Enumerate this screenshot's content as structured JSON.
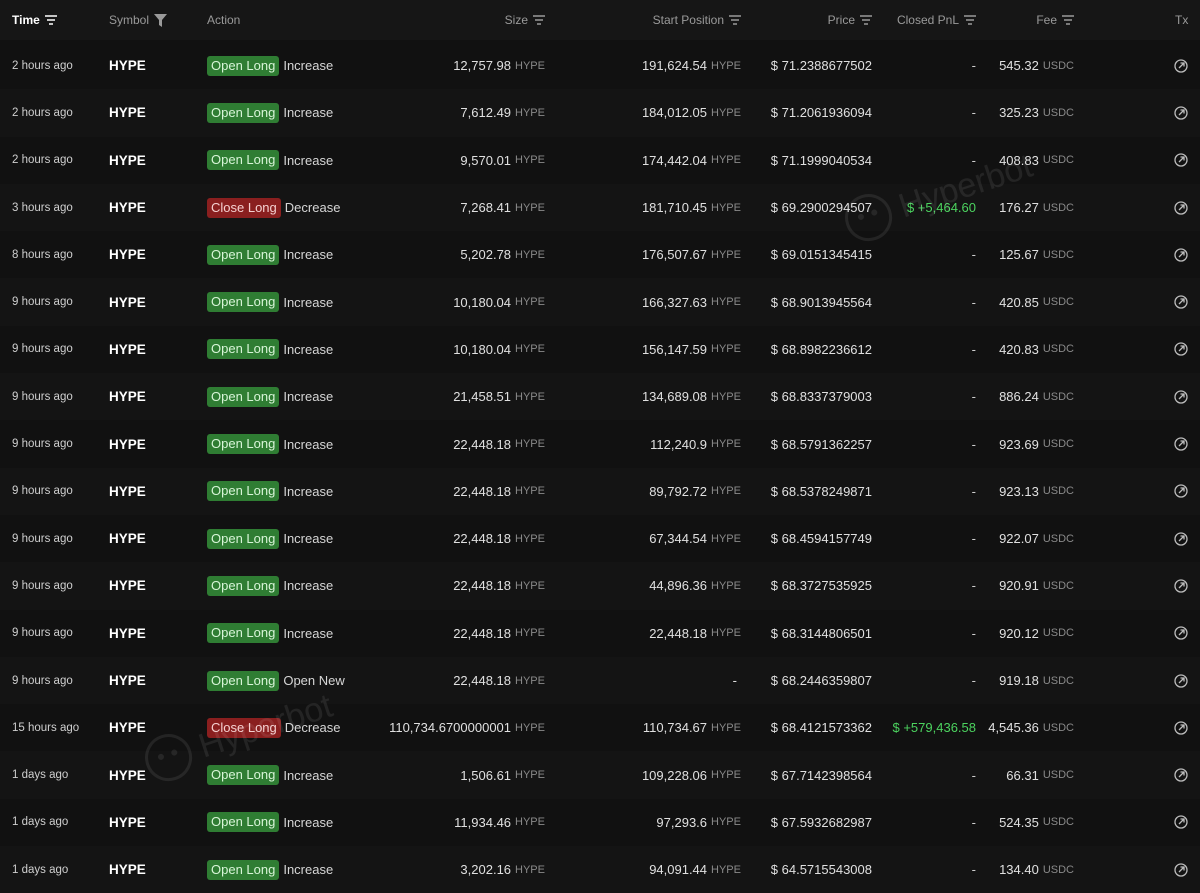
{
  "header": {
    "time": "Time",
    "symbol": "Symbol",
    "action": "Action",
    "size": "Size",
    "start_position": "Start Position",
    "price": "Price",
    "closed_pnl": "Closed PnL",
    "fee": "Fee",
    "tx": "Tx"
  },
  "watermark": "Hyperbot",
  "colors": {
    "open_badge": "#2f7d33",
    "close_badge": "#8a1f1f",
    "pnl_positive": "#4cd35f",
    "background": "#111111"
  },
  "rows": [
    {
      "time": "2 hours ago",
      "symbol": "HYPE",
      "badge": "Open Long",
      "badge_type": "open",
      "action": "Increase",
      "size": "12,757.98",
      "size_unit": "HYPE",
      "start": "191,624.54",
      "start_unit": "HYPE",
      "price": "$ 71.2388677502",
      "pnl": "-",
      "pnl_positive": false,
      "fee": "545.32",
      "fee_unit": "USDC"
    },
    {
      "time": "2 hours ago",
      "symbol": "HYPE",
      "badge": "Open Long",
      "badge_type": "open",
      "action": "Increase",
      "size": "7,612.49",
      "size_unit": "HYPE",
      "start": "184,012.05",
      "start_unit": "HYPE",
      "price": "$ 71.2061936094",
      "pnl": "-",
      "pnl_positive": false,
      "fee": "325.23",
      "fee_unit": "USDC"
    },
    {
      "time": "2 hours ago",
      "symbol": "HYPE",
      "badge": "Open Long",
      "badge_type": "open",
      "action": "Increase",
      "size": "9,570.01",
      "size_unit": "HYPE",
      "start": "174,442.04",
      "start_unit": "HYPE",
      "price": "$ 71.1999040534",
      "pnl": "-",
      "pnl_positive": false,
      "fee": "408.83",
      "fee_unit": "USDC"
    },
    {
      "time": "3 hours ago",
      "symbol": "HYPE",
      "badge": "Close Long",
      "badge_type": "close",
      "action": "Decrease",
      "size": "7,268.41",
      "size_unit": "HYPE",
      "start": "181,710.45",
      "start_unit": "HYPE",
      "price": "$ 69.2900294507",
      "pnl": "$ +5,464.60",
      "pnl_positive": true,
      "fee": "176.27",
      "fee_unit": "USDC"
    },
    {
      "time": "8 hours ago",
      "symbol": "HYPE",
      "badge": "Open Long",
      "badge_type": "open",
      "action": "Increase",
      "size": "5,202.78",
      "size_unit": "HYPE",
      "start": "176,507.67",
      "start_unit": "HYPE",
      "price": "$ 69.0151345415",
      "pnl": "-",
      "pnl_positive": false,
      "fee": "125.67",
      "fee_unit": "USDC"
    },
    {
      "time": "9 hours ago",
      "symbol": "HYPE",
      "badge": "Open Long",
      "badge_type": "open",
      "action": "Increase",
      "size": "10,180.04",
      "size_unit": "HYPE",
      "start": "166,327.63",
      "start_unit": "HYPE",
      "price": "$ 68.9013945564",
      "pnl": "-",
      "pnl_positive": false,
      "fee": "420.85",
      "fee_unit": "USDC"
    },
    {
      "time": "9 hours ago",
      "symbol": "HYPE",
      "badge": "Open Long",
      "badge_type": "open",
      "action": "Increase",
      "size": "10,180.04",
      "size_unit": "HYPE",
      "start": "156,147.59",
      "start_unit": "HYPE",
      "price": "$ 68.8982236612",
      "pnl": "-",
      "pnl_positive": false,
      "fee": "420.83",
      "fee_unit": "USDC"
    },
    {
      "time": "9 hours ago",
      "symbol": "HYPE",
      "badge": "Open Long",
      "badge_type": "open",
      "action": "Increase",
      "size": "21,458.51",
      "size_unit": "HYPE",
      "start": "134,689.08",
      "start_unit": "HYPE",
      "price": "$ 68.8337379003",
      "pnl": "-",
      "pnl_positive": false,
      "fee": "886.24",
      "fee_unit": "USDC"
    },
    {
      "time": "9 hours ago",
      "symbol": "HYPE",
      "badge": "Open Long",
      "badge_type": "open",
      "action": "Increase",
      "size": "22,448.18",
      "size_unit": "HYPE",
      "start": "112,240.9",
      "start_unit": "HYPE",
      "price": "$ 68.5791362257",
      "pnl": "-",
      "pnl_positive": false,
      "fee": "923.69",
      "fee_unit": "USDC"
    },
    {
      "time": "9 hours ago",
      "symbol": "HYPE",
      "badge": "Open Long",
      "badge_type": "open",
      "action": "Increase",
      "size": "22,448.18",
      "size_unit": "HYPE",
      "start": "89,792.72",
      "start_unit": "HYPE",
      "price": "$ 68.5378249871",
      "pnl": "-",
      "pnl_positive": false,
      "fee": "923.13",
      "fee_unit": "USDC"
    },
    {
      "time": "9 hours ago",
      "symbol": "HYPE",
      "badge": "Open Long",
      "badge_type": "open",
      "action": "Increase",
      "size": "22,448.18",
      "size_unit": "HYPE",
      "start": "67,344.54",
      "start_unit": "HYPE",
      "price": "$ 68.4594157749",
      "pnl": "-",
      "pnl_positive": false,
      "fee": "922.07",
      "fee_unit": "USDC"
    },
    {
      "time": "9 hours ago",
      "symbol": "HYPE",
      "badge": "Open Long",
      "badge_type": "open",
      "action": "Increase",
      "size": "22,448.18",
      "size_unit": "HYPE",
      "start": "44,896.36",
      "start_unit": "HYPE",
      "price": "$ 68.3727535925",
      "pnl": "-",
      "pnl_positive": false,
      "fee": "920.91",
      "fee_unit": "USDC"
    },
    {
      "time": "9 hours ago",
      "symbol": "HYPE",
      "badge": "Open Long",
      "badge_type": "open",
      "action": "Increase",
      "size": "22,448.18",
      "size_unit": "HYPE",
      "start": "22,448.18",
      "start_unit": "HYPE",
      "price": "$ 68.3144806501",
      "pnl": "-",
      "pnl_positive": false,
      "fee": "920.12",
      "fee_unit": "USDC"
    },
    {
      "time": "9 hours ago",
      "symbol": "HYPE",
      "badge": "Open Long",
      "badge_type": "open",
      "action": "Open New",
      "size": "22,448.18",
      "size_unit": "HYPE",
      "start": "-",
      "start_unit": "",
      "price": "$ 68.2446359807",
      "pnl": "-",
      "pnl_positive": false,
      "fee": "919.18",
      "fee_unit": "USDC"
    },
    {
      "time": "15 hours ago",
      "symbol": "HYPE",
      "badge": "Close Long",
      "badge_type": "close",
      "action": "Decrease",
      "size": "110,734.6700000001",
      "size_unit": "HYPE",
      "start": "110,734.67",
      "start_unit": "HYPE",
      "price": "$ 68.4121573362",
      "pnl": "$ +579,436.58",
      "pnl_positive": true,
      "fee": "4,545.36",
      "fee_unit": "USDC"
    },
    {
      "time": "1 days ago",
      "symbol": "HYPE",
      "badge": "Open Long",
      "badge_type": "open",
      "action": "Increase",
      "size": "1,506.61",
      "size_unit": "HYPE",
      "start": "109,228.06",
      "start_unit": "HYPE",
      "price": "$ 67.7142398564",
      "pnl": "-",
      "pnl_positive": false,
      "fee": "66.31",
      "fee_unit": "USDC"
    },
    {
      "time": "1 days ago",
      "symbol": "HYPE",
      "badge": "Open Long",
      "badge_type": "open",
      "action": "Increase",
      "size": "11,934.46",
      "size_unit": "HYPE",
      "start": "97,293.6",
      "start_unit": "HYPE",
      "price": "$ 67.5932682987",
      "pnl": "-",
      "pnl_positive": false,
      "fee": "524.35",
      "fee_unit": "USDC"
    },
    {
      "time": "1 days ago",
      "symbol": "HYPE",
      "badge": "Open Long",
      "badge_type": "open",
      "action": "Increase",
      "size": "3,202.16",
      "size_unit": "HYPE",
      "start": "94,091.44",
      "start_unit": "HYPE",
      "price": "$ 64.5715543008",
      "pnl": "-",
      "pnl_positive": false,
      "fee": "134.40",
      "fee_unit": "USDC"
    }
  ]
}
